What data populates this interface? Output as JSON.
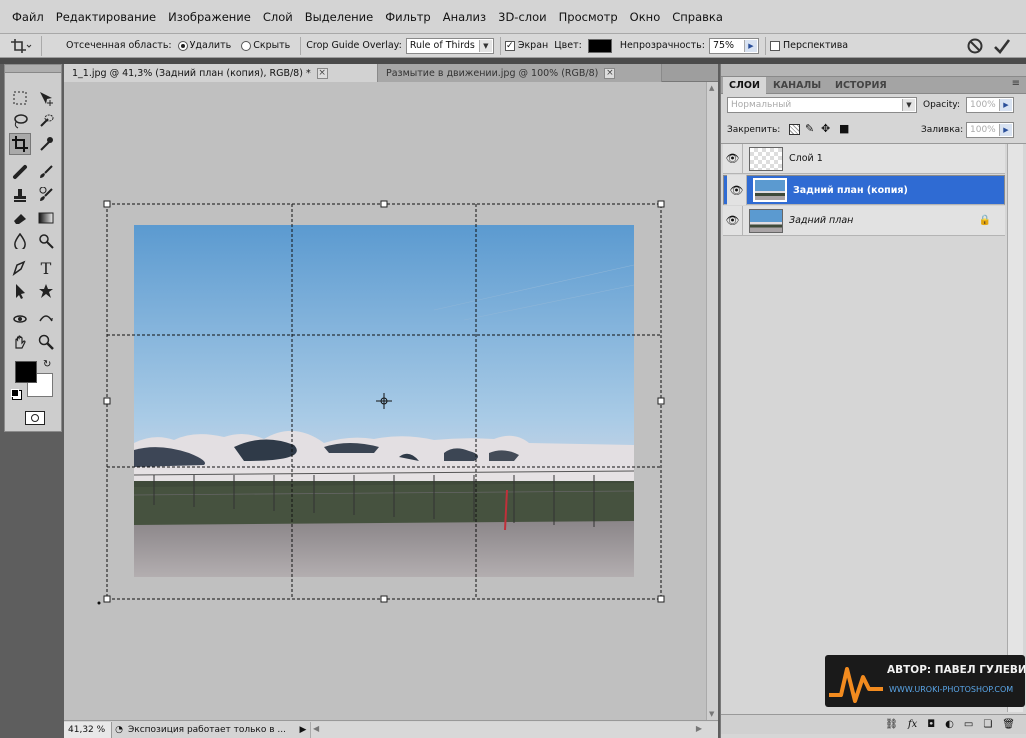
{
  "menu": [
    "Файл",
    "Редактирование",
    "Изображение",
    "Слой",
    "Выделение",
    "Фильтр",
    "Анализ",
    "3D-слои",
    "Просмотр",
    "Окно",
    "Справка"
  ],
  "options": {
    "cropped_area_label": "Отсеченная область:",
    "delete_label": "Удалить",
    "hide_label": "Скрыть",
    "overlay_label": "Crop Guide Overlay:",
    "overlay_value": "Rule of Thirds",
    "shield_label": "Экран",
    "color_label": "Цвет:",
    "opacity_label": "Непрозрачность:",
    "opacity_value": "75%",
    "perspective_label": "Перспектива"
  },
  "tabs": [
    {
      "label": "1_1.jpg @ 41,3% (Задний план (копия), RGB/8) *",
      "active": true
    },
    {
      "label": "Размытие в движении.jpg @ 100% (RGB/8)",
      "active": false
    }
  ],
  "status": {
    "zoom": "41,32 %",
    "info": "Экспозиция работает только в ..."
  },
  "panel": {
    "tabs": [
      "СЛОИ",
      "КАНАЛЫ",
      "ИСТОРИЯ"
    ],
    "blend_mode": "Нормальный",
    "opacity_label": "Opacity:",
    "opacity_value": "100%",
    "lock_label": "Закрепить:",
    "fill_label": "Заливка:",
    "fill_value": "100%",
    "layers": [
      {
        "name": "Слой 1",
        "selected": false,
        "type": "transparent"
      },
      {
        "name": "Задний план (копия)",
        "selected": true,
        "type": "photo"
      },
      {
        "name": "Задний план",
        "selected": false,
        "type": "photo",
        "locked": true
      }
    ]
  },
  "watermark": {
    "author": "АВТОР: ПАВЕЛ ГУЛЕВИЧ",
    "site": "WWW.UROKI-PHOTOSHOP.COM"
  },
  "colors": {
    "selected_layer": "#2f6bd3",
    "foreground": "#000000",
    "background": "#ffffff"
  }
}
